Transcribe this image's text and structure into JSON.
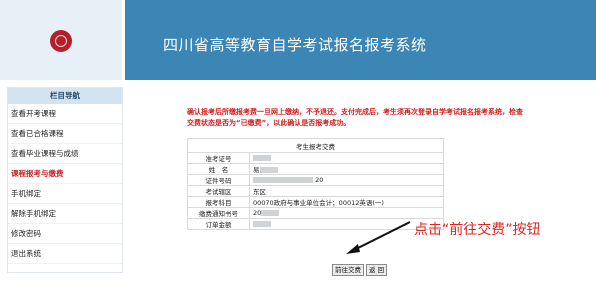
{
  "header": {
    "title": "四川省高等教育自学考试报名报考系统"
  },
  "sidebar": {
    "title": "栏目导航",
    "items": [
      {
        "label": "查看开考课程"
      },
      {
        "label": "查看已合格课程"
      },
      {
        "label": "查看毕业课程与成绩"
      },
      {
        "label": "课程报考与缴费"
      },
      {
        "label": "手机绑定"
      },
      {
        "label": "解除手机绑定"
      },
      {
        "label": "修改密码"
      },
      {
        "label": "退出系统"
      }
    ],
    "active_index": 3
  },
  "notice": {
    "text": "确认报考后所缴报考费一旦网上缴纳，不予退还。支付完成后，考生须再次登录自学考试报名报考系统，检查交费状态是否为“已缴费”，以此确认是否报考成功。"
  },
  "fee_table": {
    "title": "考生报考交费",
    "rows": [
      {
        "label": "准考证号",
        "value": ""
      },
      {
        "label": "姓　名",
        "value": "易"
      },
      {
        "label": "证件号码",
        "value": "20"
      },
      {
        "label": "考试辖区",
        "value": "东区"
      },
      {
        "label": "报考科目",
        "value": "00070政府与事业单位会计；00012英语(一)"
      },
      {
        "label": "缴费通知书号",
        "value": "20"
      },
      {
        "label": "订单金额",
        "value": ""
      }
    ]
  },
  "buttons": {
    "pay": "前往交费",
    "back": "返 回"
  },
  "annotation": {
    "text": "点击“前往交费”按钮"
  },
  "colors": {
    "header_bg": "#3b86b4",
    "accent_red": "#d21c1c",
    "logo_red": "#b3202a"
  }
}
